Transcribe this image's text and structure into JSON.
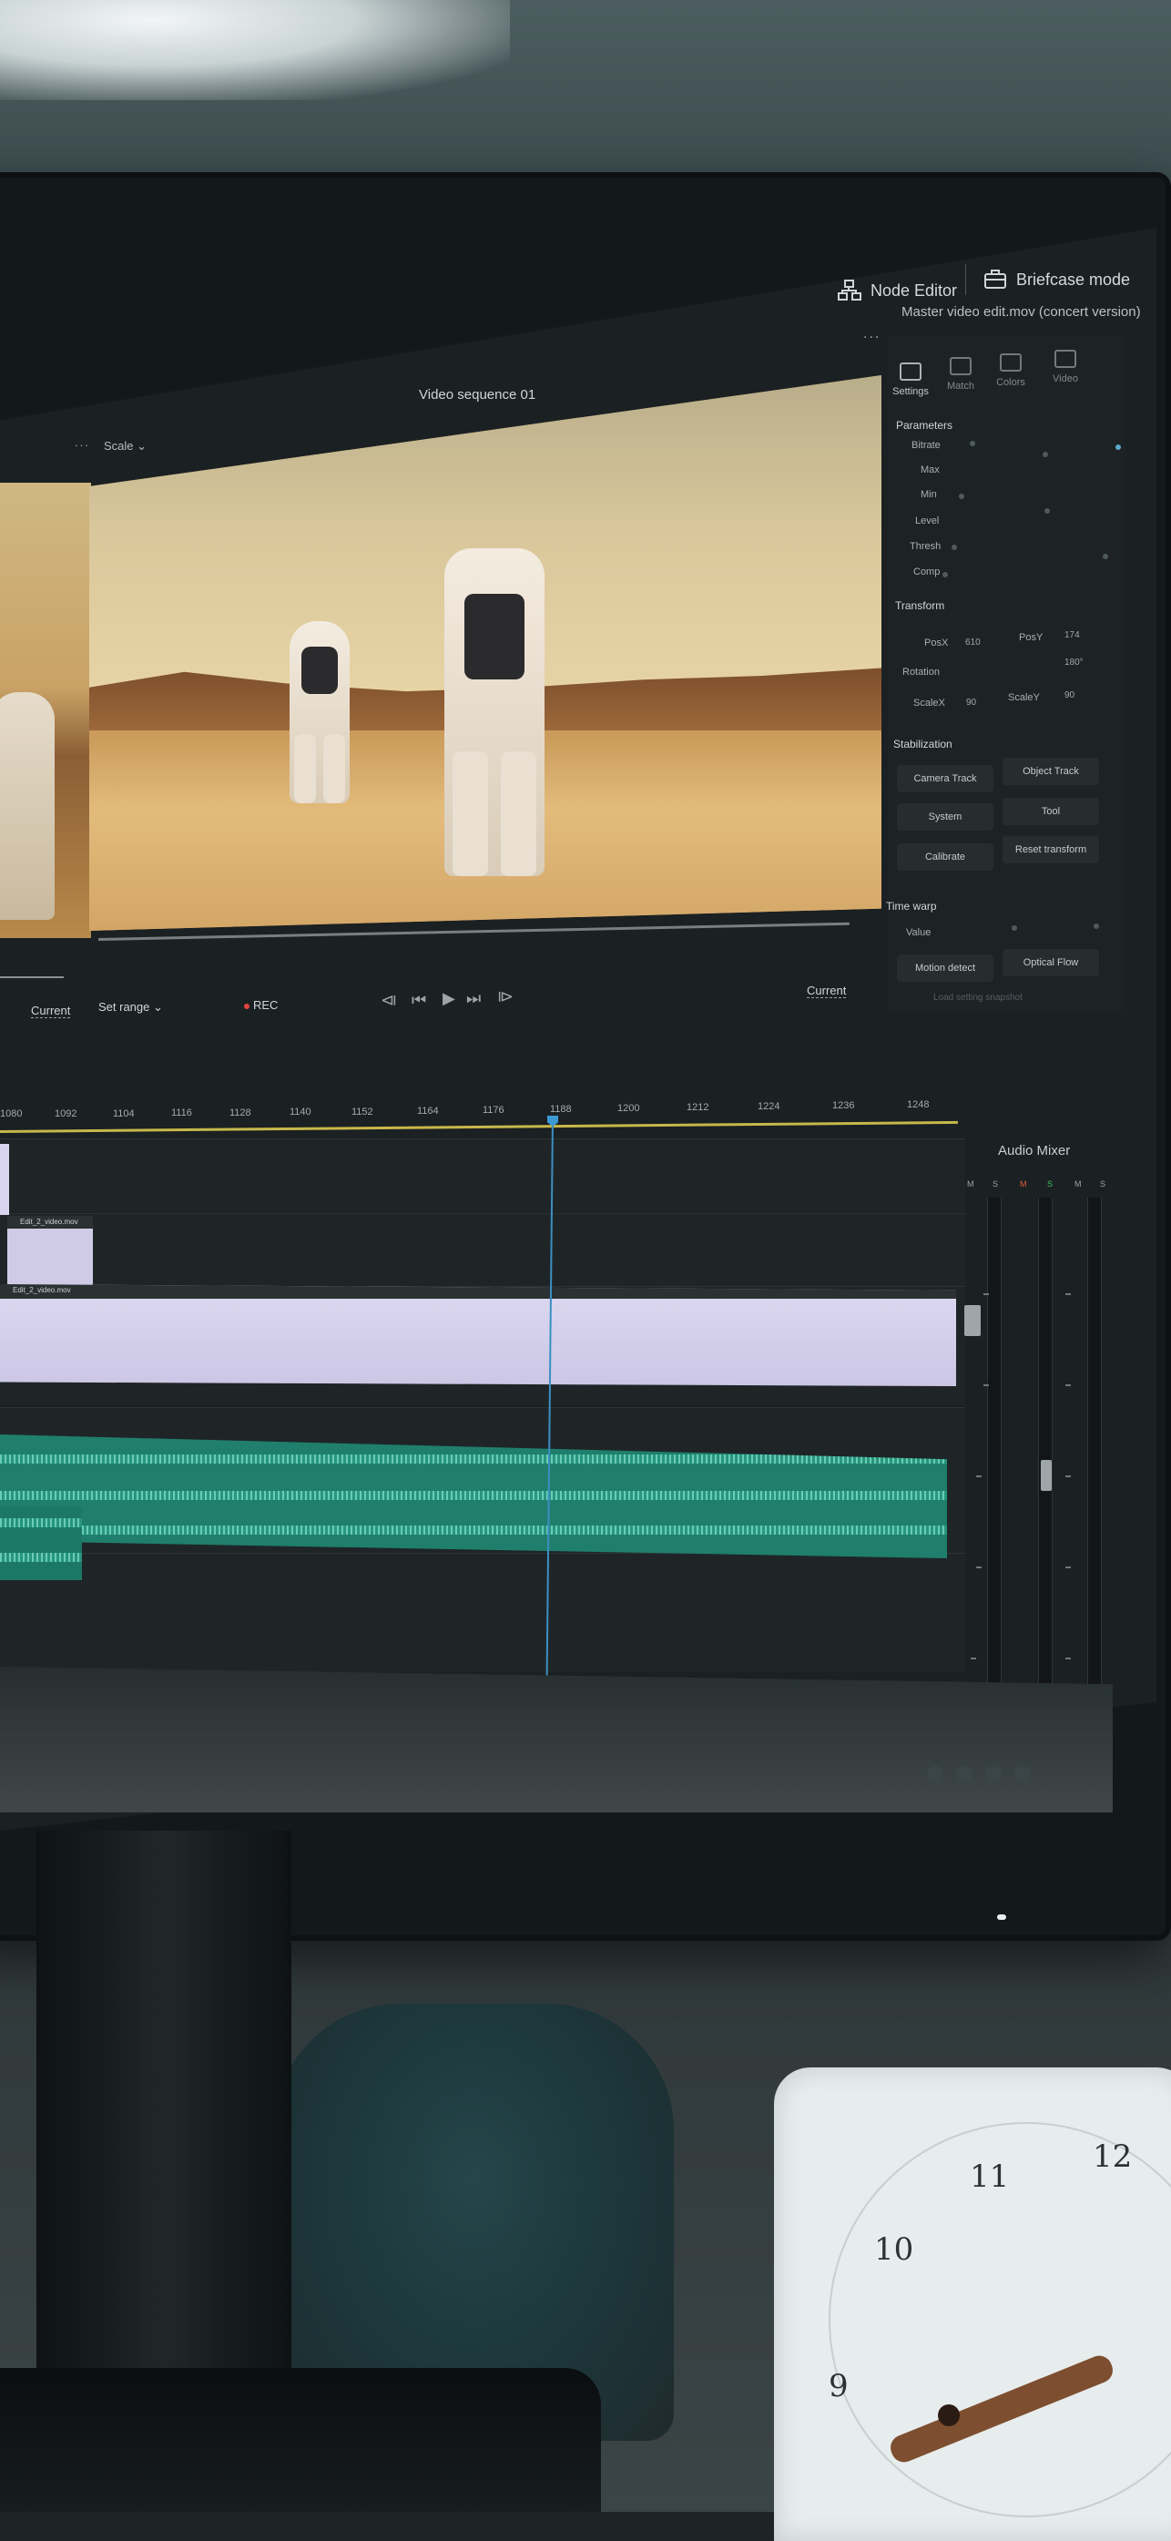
{
  "header": {
    "node_editor_label": "Node Editor",
    "briefcase_label": "Briefcase mode",
    "file_title": "Master video edit.mov (concert version)",
    "more_dots": "...",
    "left_dots": "..."
  },
  "viewer": {
    "sequence_title": "Video sequence 01",
    "scale_label": "Scale ⌄"
  },
  "transport": {
    "left_current": "Current",
    "set_range": "Set range ⌄",
    "rec": "REC",
    "right_current": "Current",
    "buttons": [
      "⧏",
      "⏮",
      "▶",
      "⏭",
      "⧐"
    ]
  },
  "inspector": {
    "tabs": [
      "Settings",
      "Match",
      "Colors",
      "Video"
    ],
    "parameters_title": "Parameters",
    "parameters": [
      "Bitrate",
      "Max",
      "Min",
      "Level",
      "Thresh",
      "Comp"
    ],
    "transform_title": "Transform",
    "position_label": "PosX",
    "position_x": "610",
    "position_y_label": "PosY",
    "position_y": "174",
    "rotation_label": "Rotation",
    "rotation_value": "180°",
    "scale_x_label": "ScaleX",
    "scale_x": "90",
    "scale_y_label": "ScaleY",
    "scale_y": "90",
    "stabilization_title": "Stabilization",
    "camera_track": "Camera Track",
    "object_track": "Object Track",
    "system": "System",
    "tool": "Tool",
    "calibrate": "Calibrate",
    "reset_transform": "Reset transform",
    "time_warp_title": "Time warp",
    "value_label": "Value",
    "motion_detect": "Motion detect",
    "optical_flow": "Optical Flow",
    "faint_note": "Load setting snapshot"
  },
  "ruler": {
    "ticks": [
      "1080",
      "1092",
      "1104",
      "1116",
      "1128",
      "1140",
      "1152",
      "1164",
      "1176",
      "1188",
      "1200",
      "1212",
      "1224",
      "1236",
      "1248"
    ]
  },
  "timeline": {
    "clip_small_name": "Edit_2_video.mov",
    "clip_big_name": "Edit_2_video.mov"
  },
  "mixer": {
    "title": "Audio Mixer",
    "channels": [
      "M",
      "S",
      "M",
      "S",
      "M",
      "S"
    ]
  },
  "colors": {
    "accent_blue": "#3b8fc2",
    "rec_red": "#e2463c",
    "audio_green": "#1f7f6c",
    "video_clip": "#cfcbe7",
    "ruler_yellow": "#c8b84a"
  }
}
